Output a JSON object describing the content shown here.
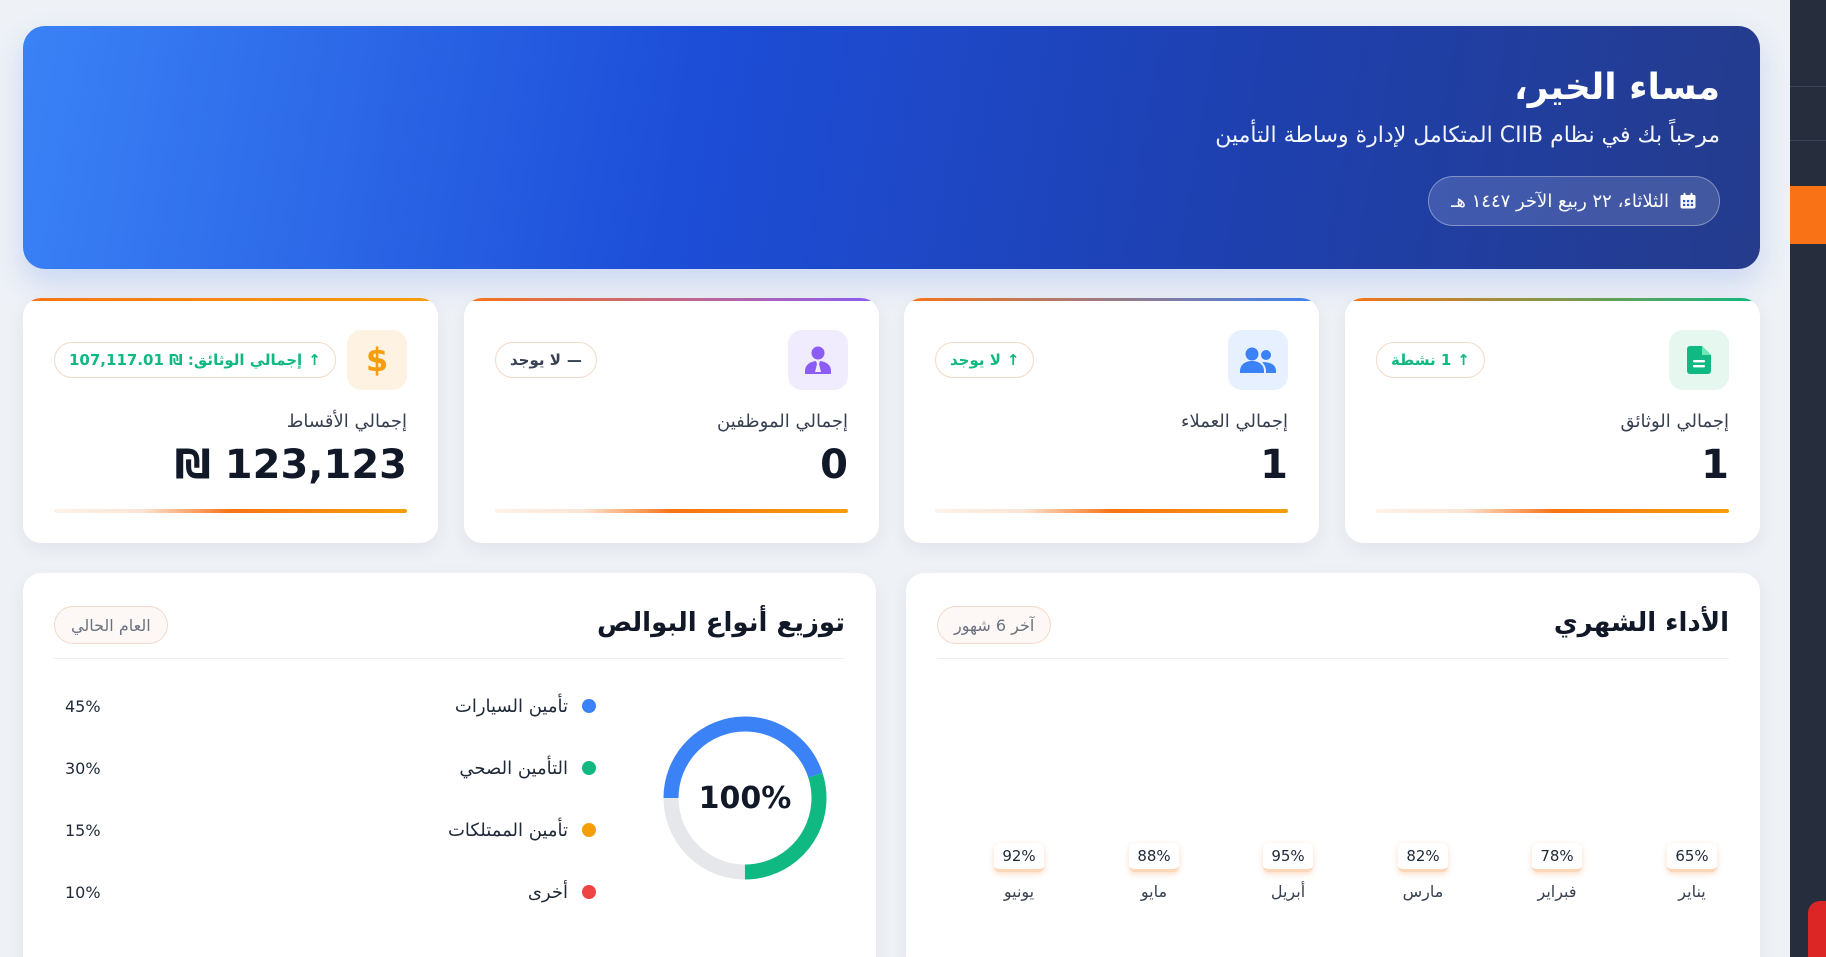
{
  "hero": {
    "greeting": "مساء الخير،",
    "welcome": "مرحباً بك في نظام CIIB المتكامل لإدارة وساطة التأمين",
    "date": "الثلاثاء، ٢٢ ربيع الآخر ١٤٤٧ هـ",
    "date_icon": "calendar-icon"
  },
  "stats": [
    {
      "label": "إجمالي الوثائق",
      "value": "1",
      "trend": "1 نشطة",
      "trend_icon": "arrow-up-icon",
      "icon": "document-icon",
      "icon_color": "#10b981",
      "icon_bg": "#e6f7f0",
      "trend_color": "#10b981",
      "topline": "#10b981"
    },
    {
      "label": "إجمالي العملاء",
      "value": "1",
      "trend": "لا يوجد",
      "trend_icon": "arrow-up-icon",
      "icon": "users-icon",
      "icon_color": "#3b82f6",
      "icon_bg": "#e7f0fe",
      "trend_color": "#10b981",
      "topline": "#3b82f6"
    },
    {
      "label": "إجمالي الموظفين",
      "value": "0",
      "trend": "لا يوجد",
      "trend_icon": "dash-icon",
      "icon": "employee-icon",
      "icon_color": "#8b5cf6",
      "icon_bg": "#f1ebfe",
      "trend_color": "#374151",
      "topline": "#8b5cf6"
    },
    {
      "label": "إجمالي الأقساط",
      "value": "₪ 123,123",
      "trend": "إجمالي الوثائق: ₪ 107,117.01",
      "trend_icon": "arrow-up-icon",
      "icon": "dollar-icon",
      "icon_color": "#f59e0b",
      "icon_bg": "#fef3e2",
      "trend_color": "#10b981",
      "topline": "#f97316"
    }
  ],
  "monthly": {
    "title": "الأداء الشهري",
    "pill": "آخر 6 شهور",
    "months": [
      {
        "name": "يناير",
        "value": "65%"
      },
      {
        "name": "فبراير",
        "value": "78%"
      },
      {
        "name": "مارس",
        "value": "82%"
      },
      {
        "name": "أبريل",
        "value": "95%"
      },
      {
        "name": "مايو",
        "value": "88%"
      },
      {
        "name": "يونيو",
        "value": "92%"
      }
    ]
  },
  "distribution": {
    "title": "توزيع أنواع البوالص",
    "pill": "العام الحالي",
    "center_label": "100%",
    "items": [
      {
        "label": "تأمين السيارات",
        "pct": "45%",
        "value": 45,
        "color": "#3b82f6"
      },
      {
        "label": "التأمين الصحي",
        "pct": "30%",
        "value": 30,
        "color": "#10b981"
      },
      {
        "label": "تأمين الممتلكات",
        "pct": "15%",
        "value": 15,
        "color": "#f59e0b"
      },
      {
        "label": "أخرى",
        "pct": "10%",
        "value": 10,
        "color": "#ef4444"
      }
    ]
  }
}
